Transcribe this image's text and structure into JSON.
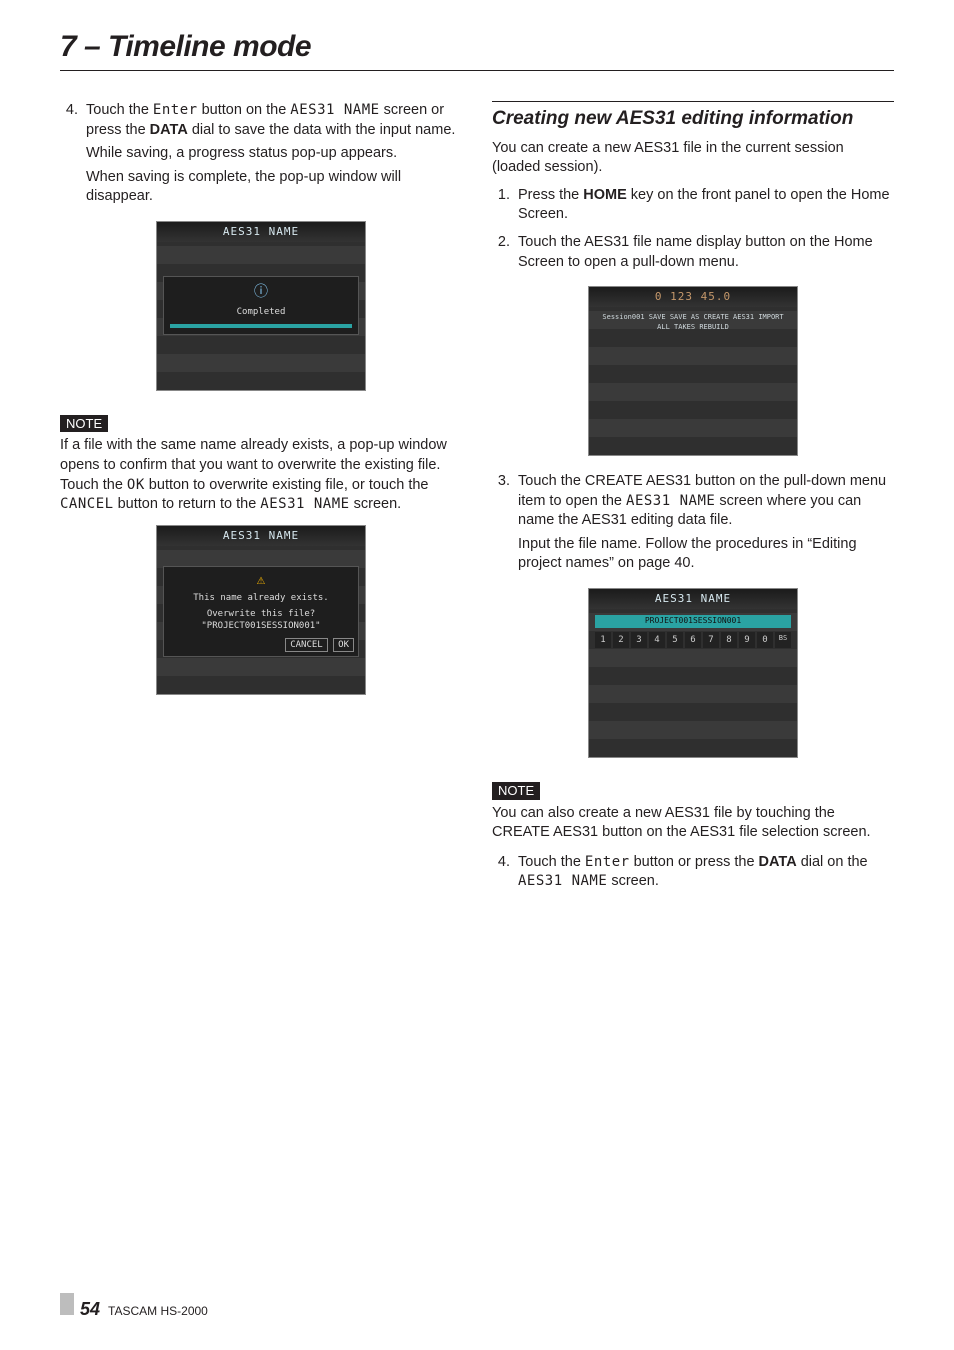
{
  "chapter": "7 – Timeline mode",
  "left": {
    "step4": {
      "num": "4.",
      "p1_a": "Touch the ",
      "p1_enter": "Enter",
      "p1_b": " button on the ",
      "p1_name": "AES31 NAME",
      "p1_c": " screen or press the ",
      "p1_data": "DATA",
      "p1_d": " dial to save the data with the input name.",
      "p2": "While saving, a progress status pop-up appears.",
      "p3": "When saving is complete, the pop-up window will disappear."
    },
    "img1": {
      "title": "AES31 NAME",
      "caption": "Completed"
    },
    "note1": {
      "label": "NOTE",
      "t_a": "If a file with the same name already exists, a pop-up window opens to confirm that you want to overwrite the existing file. Touch the ",
      "ok": "OK",
      "t_b": " button to overwrite existing file, or touch the ",
      "cancel": "CANCEL",
      "t_c": " button to return to the ",
      "name": "AES31 NAME",
      "t_d": " screen."
    },
    "img2": {
      "title": "AES31 NAME",
      "l1": "This name already exists.",
      "l2": "Overwrite this file?",
      "l3": "\"PROJECT001SESSION001\"",
      "btn1": "CANCEL",
      "btn2": "OK"
    }
  },
  "right": {
    "heading": "Creating new AES31 editing information",
    "intro": "You can create a new AES31 file in the current session (loaded session).",
    "step1": {
      "num": "1.",
      "a": "Press the ",
      "home": "HOME",
      "b": " key on the front panel to open the Home Screen."
    },
    "step2": {
      "num": "2.",
      "t": "Touch the AES31 file name display button on the Home Screen to open a pull-down menu."
    },
    "img3": {
      "caption": "Session001  SAVE  SAVE AS  CREATE AES31  IMPORT ALL TAKES  REBUILD"
    },
    "step3": {
      "num": "3.",
      "p1_a": "Touch the CREATE AES31 button on the pull-down menu item to open the ",
      "p1_name": "AES31 NAME",
      "p1_b": " screen where you can name the AES31 editing data file.",
      "p2": "Input the file name. Follow the procedures in “Editing project names” on page 40."
    },
    "img4": {
      "title": "AES31 NAME",
      "text": "PROJECT001SESSION001"
    },
    "note2": {
      "label": "NOTE",
      "t": "You can also create a new AES31 file by touching the CREATE AES31 button on the AES31 file selection screen."
    },
    "step4b": {
      "num": "4.",
      "a": "Touch the ",
      "enter": "Enter",
      "b": " button or press the ",
      "data": "DATA",
      "c": " dial on the ",
      "name": "AES31 NAME",
      "d": " screen."
    }
  },
  "footer": {
    "page": "54",
    "model": "TASCAM  HS-2000"
  }
}
